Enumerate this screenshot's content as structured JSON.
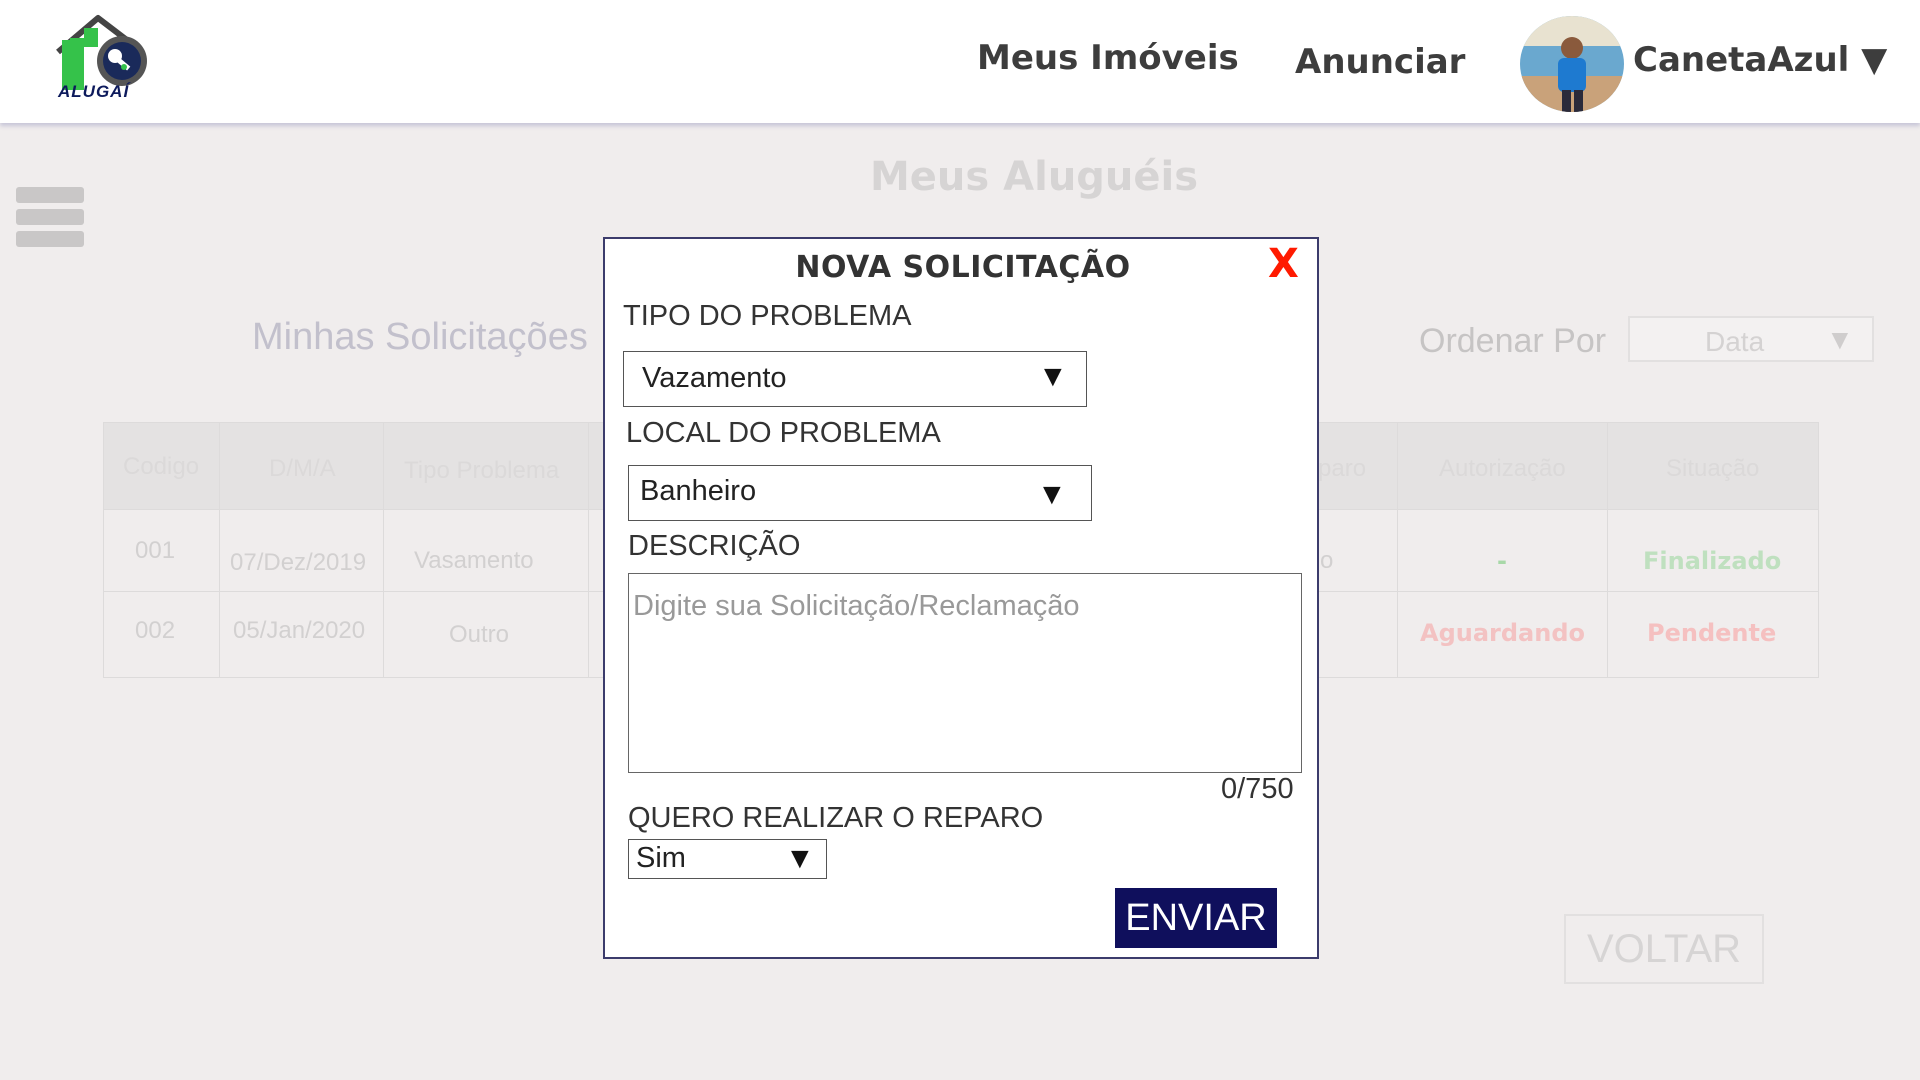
{
  "header": {
    "logo_text": "ALUGAÍ",
    "nav": {
      "meus_imoveis": "Meus Imóveis",
      "anunciar": "Anunciar"
    },
    "user": {
      "name": "CanetaAzul",
      "dropdown_arrow": "▼"
    }
  },
  "page": {
    "title": "Meus Aluguéis",
    "subtitle": "Minhas Solicitações",
    "sort": {
      "label": "Ordenar Por",
      "value": "Data",
      "arrow": "▼"
    }
  },
  "table": {
    "headers": {
      "codigo": "Codigo",
      "data": "D/M/A",
      "tipo": "Tipo Problema",
      "reparo": "paro",
      "autorizacao": "Autorização",
      "situacao": "Situação"
    },
    "rows": [
      {
        "codigo": "001",
        "data": "07/Dez/2019",
        "tipo": "Vasamento",
        "reparo": "o",
        "autorizacao": "-",
        "situacao": "Finalizado"
      },
      {
        "codigo": "002",
        "data": "05/Jan/2020",
        "tipo": "Outro",
        "autorizacao": "Aguardando",
        "situacao": "Pendente"
      }
    ]
  },
  "status_colors": {
    "finalizado": "#bfe0bf",
    "aguardando": "#f3c2c2",
    "pendente": "#f5c0c0",
    "dash": "#a8d8a8"
  },
  "voltar_label": "VOLTAR",
  "modal": {
    "title": "NOVA SOLICITAÇÃO",
    "close_label": "X",
    "tipo_label": "TIPO DO PROBLEMA",
    "tipo_value": "Vazamento",
    "local_label": "LOCAL DO PROBLEMA",
    "local_value": "Banheiro",
    "descricao_label": "DESCRIÇÃO",
    "descricao_placeholder": "Digite sua Solicitação/Reclamação",
    "counter": "0/750",
    "reparo_label": "QUERO REALIZAR O REPARO",
    "reparo_value": "Sim",
    "arrow": "▼",
    "submit_label": "ENVIAR"
  },
  "colors": {
    "accent": "#0f0f5c",
    "close": "#ff1a00",
    "logo_green": "#35c24a"
  }
}
